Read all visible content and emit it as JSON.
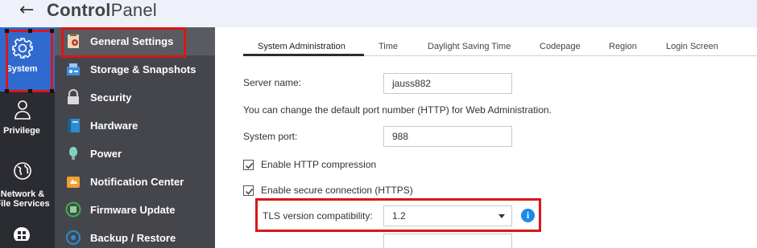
{
  "window": {
    "back_glyph": "←",
    "title_bold": "Control",
    "title_rest": "Panel"
  },
  "rail": [
    {
      "label": "System",
      "icon": "gear-icon"
    },
    {
      "label": "Privilege",
      "icon": "user-icon"
    },
    {
      "label_line1": "Network &",
      "label_line2": "File Services",
      "icon": "globe-icon"
    },
    {
      "label": "",
      "icon": "apps-grid-icon"
    }
  ],
  "nav": {
    "items": [
      {
        "label": "General Settings",
        "icon": "general-settings-icon"
      },
      {
        "label": "Storage & Snapshots",
        "icon": "storage-icon"
      },
      {
        "label": "Security",
        "icon": "lock-icon"
      },
      {
        "label": "Hardware",
        "icon": "hardware-icon"
      },
      {
        "label": "Power",
        "icon": "power-icon"
      },
      {
        "label": "Notification Center",
        "icon": "notification-icon"
      },
      {
        "label": "Firmware Update",
        "icon": "firmware-icon"
      },
      {
        "label": "Backup / Restore",
        "icon": "backup-icon"
      }
    ]
  },
  "tabs": [
    {
      "label": "System Administration",
      "active": true
    },
    {
      "label": "Time"
    },
    {
      "label": "Daylight Saving Time"
    },
    {
      "label": "Codepage"
    },
    {
      "label": "Region"
    },
    {
      "label": "Login Screen"
    }
  ],
  "form": {
    "server_name_label": "Server name:",
    "server_name_value": "jauss882",
    "port_note": "You can change the default port number (HTTP) for Web Administration.",
    "system_port_label": "System port:",
    "system_port_value": "988",
    "http_compression_label": "Enable HTTP compression",
    "http_compression_checked": true,
    "https_label": "Enable secure connection (HTTPS)",
    "https_checked": true,
    "tls_label": "TLS version compatibility:",
    "tls_value": "1.2",
    "info_glyph": "i"
  },
  "colors": {
    "accent": "#2f6ad0",
    "highlight_box": "#d81717",
    "info": "#1a8be6"
  }
}
